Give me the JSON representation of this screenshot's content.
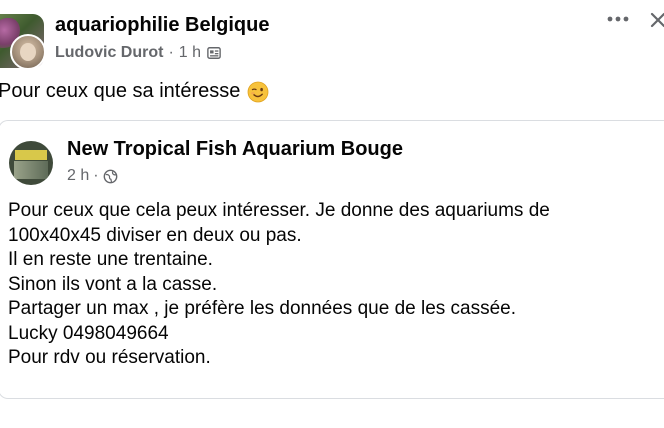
{
  "post": {
    "group_name": "aquariophilie Belgique",
    "author": "Ludovic Durot",
    "separator": "·",
    "time": "1 h",
    "text": "Pour ceux que sa intéresse",
    "emoji": "winking-face-emoji"
  },
  "header_actions": {
    "more_icon": "more-horizontal-icon",
    "close_icon": "close-icon"
  },
  "shared_post": {
    "page_name": "New Tropical Fish Aquarium Bouge",
    "time": "2 h",
    "separator": "·",
    "visibility_icon": "globe-icon",
    "body_lines": [
      "Pour ceux que cela peux intéresser. Je donne des aquariums de",
      "100x40x45 diviser en deux ou pas.",
      "Il en reste une trentaine.",
      "Sinon ils vont a la casse.",
      "Partager un max , je préfère les données que de les cassée.",
      "Lucky 0498049664",
      "Pour rdv ou réservation."
    ]
  },
  "colors": {
    "primary_text": "#050505",
    "secondary_text": "#65676b",
    "divider": "#dadde1",
    "background": "#ffffff"
  }
}
